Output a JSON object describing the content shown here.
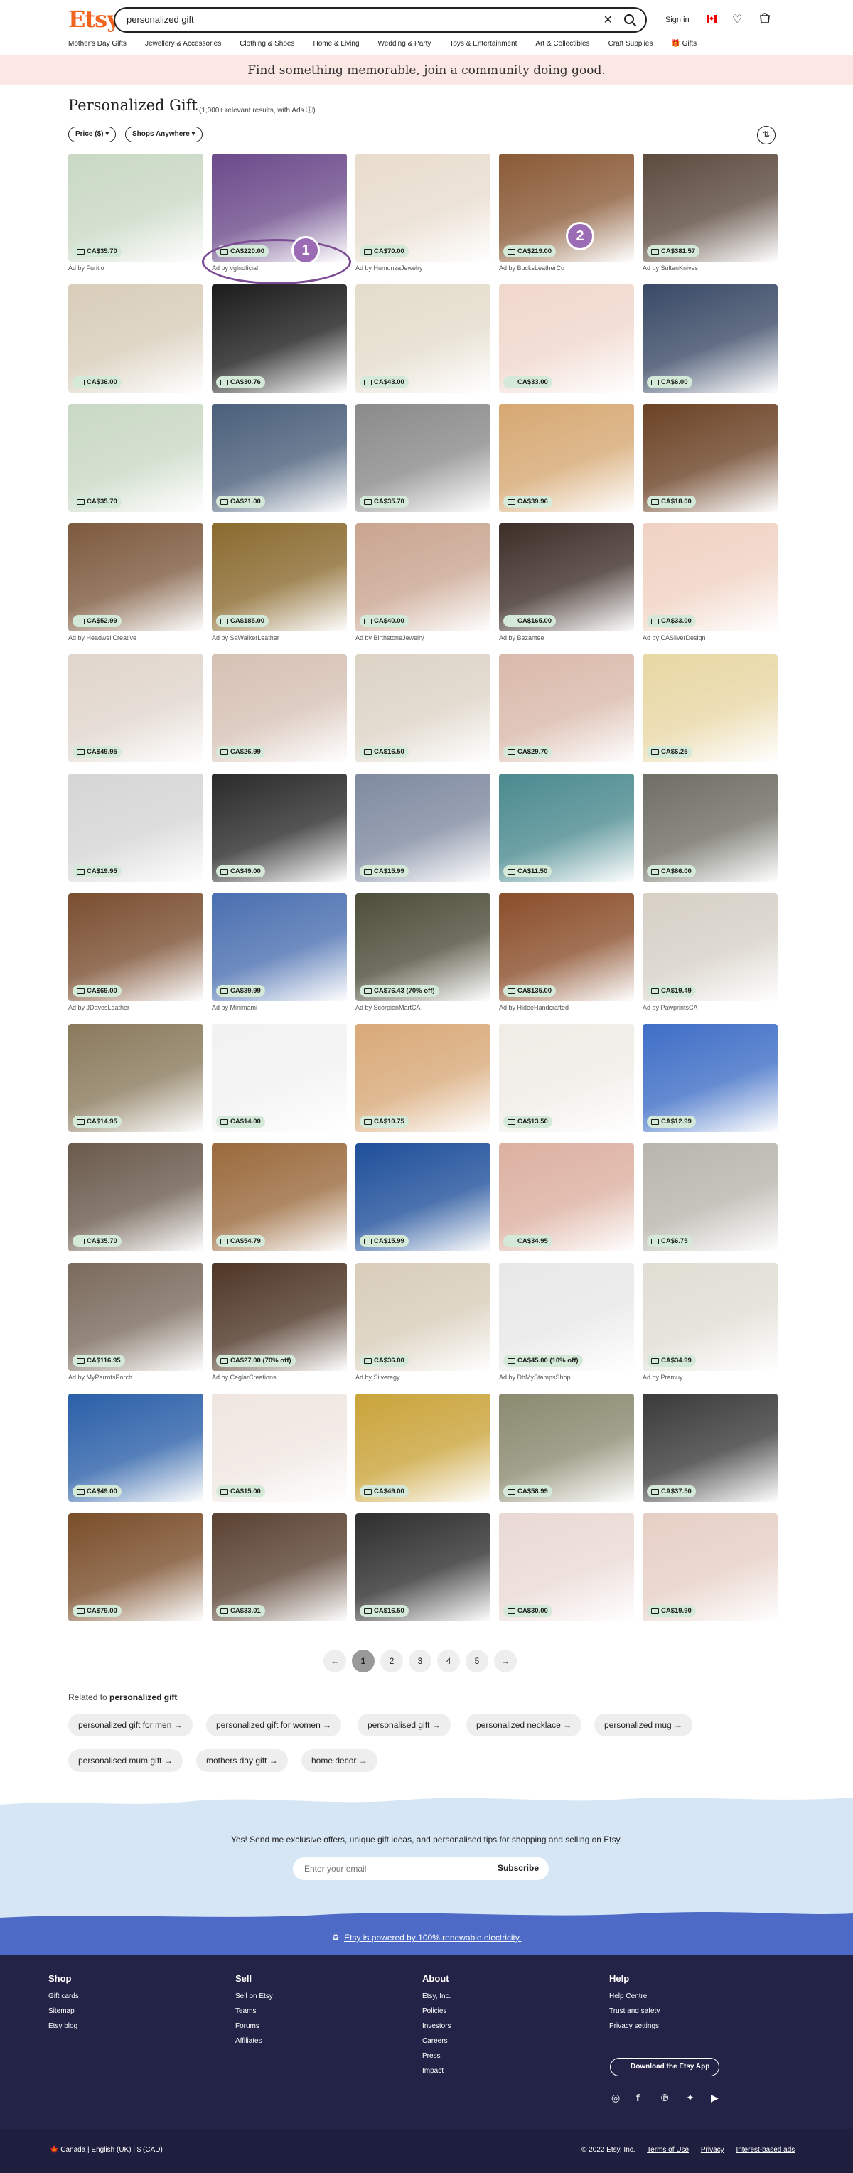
{
  "header": {
    "logo": "Etsy",
    "search_value": "personalized gift",
    "signin": "Sign in",
    "nav": [
      "Mother's Day Gifts",
      "Jewellery & Accessories",
      "Clothing & Shoes",
      "Home & Living",
      "Wedding & Party",
      "Toys & Entertainment",
      "Art & Collectibles",
      "Craft Supplies",
      "Gifts"
    ]
  },
  "banner": "Find something memorable, join a community doing good.",
  "results": {
    "title": "Personalized Gift",
    "count": "(1,000+ relevant results, with Ads",
    "filters": [
      "Price ($) ▾",
      "Shops Anywhere ▾"
    ]
  },
  "listings": [
    {
      "price": "CA$35.70",
      "ad": "Ad by Furitio",
      "color": "#c9d8c4"
    },
    {
      "price": "CA$220.00",
      "ad": "Ad by vglnoficial",
      "color": "#6b4a8a"
    },
    {
      "price": "CA$70.00",
      "ad": "Ad by HumunzaJewelry",
      "color": "#e8dccd"
    },
    {
      "price": "CA$219.00",
      "ad": "Ad by BucksLeatherCo",
      "color": "#8a5a36"
    },
    {
      "price": "CA$381.57",
      "ad": "Ad by SultanKnives",
      "color": "#5c4a3e"
    },
    {
      "price": "CA$36.00",
      "ad": "",
      "color": "#d8cdb9"
    },
    {
      "price": "CA$30.76",
      "ad": "",
      "color": "#1c1c1c"
    },
    {
      "price": "CA$43.00",
      "ad": "",
      "color": "#e4dccb"
    },
    {
      "price": "CA$33.00",
      "ad": "",
      "color": "#f0d7cc"
    },
    {
      "price": "CA$6.00",
      "ad": "",
      "color": "#3a4a66"
    },
    {
      "price": "CA$35.70",
      "ad": "",
      "color": "#c9d8c4"
    },
    {
      "price": "CA$21.00",
      "ad": "",
      "color": "#4a5f7a"
    },
    {
      "price": "CA$35.70",
      "ad": "",
      "color": "#8a8a8a"
    },
    {
      "price": "CA$39.96",
      "ad": "",
      "color": "#d6a872"
    },
    {
      "price": "CA$18.00",
      "ad": "",
      "color": "#6b4225"
    },
    {
      "price": "CA$52.99",
      "ad": "Ad by HeadwellCreative",
      "color": "#7d5a3e"
    },
    {
      "price": "CA$185.00",
      "ad": "Ad by SaWalkerLeather",
      "color": "#8a6a2e"
    },
    {
      "price": "CA$40.00",
      "ad": "Ad by BirthstoneJewelry",
      "color": "#c9a590"
    },
    {
      "price": "CA$165.00",
      "ad": "Ad by Bezantee",
      "color": "#3e2e28"
    },
    {
      "price": "CA$33.00",
      "ad": "Ad by CASilverDesign",
      "color": "#f0d2c2"
    },
    {
      "price": "CA$49.95",
      "ad": "",
      "color": "#e0d5cc"
    },
    {
      "price": "CA$26.99",
      "ad": "",
      "color": "#d6c1b4"
    },
    {
      "price": "CA$16.50",
      "ad": "",
      "color": "#dcd3c5"
    },
    {
      "price": "CA$29.70",
      "ad": "",
      "color": "#d9b9aa"
    },
    {
      "price": "CA$6.25",
      "ad": "",
      "color": "#e8d7a4"
    },
    {
      "price": "CA$19.95",
      "ad": "",
      "color": "#d5d5d5"
    },
    {
      "price": "CA$49.00",
      "ad": "",
      "color": "#2a2a2a"
    },
    {
      "price": "CA$15.99",
      "ad": "",
      "color": "#7f8aa0"
    },
    {
      "price": "CA$11.50",
      "ad": "",
      "color": "#4a8a8f"
    },
    {
      "price": "CA$86.00",
      "ad": "",
      "color": "#6e6e64"
    },
    {
      "price": "CA$69.00",
      "ad": "Ad by JDavesLeather",
      "color": "#7a4e30"
    },
    {
      "price": "CA$39.99",
      "ad": "Ad by Minimami",
      "color": "#4a6fb0"
    },
    {
      "price": "CA$76.43 (70% off)",
      "ad": "Ad by ScorpionMartCA",
      "color": "#4d4d3a"
    },
    {
      "price": "CA$135.00",
      "ad": "Ad by HideeHandcrafted",
      "color": "#8a4e2a"
    },
    {
      "price": "CA$19.49",
      "ad": "Ad by PawprintsCA",
      "color": "#d6d0c6"
    },
    {
      "price": "CA$14.95",
      "ad": "",
      "color": "#8a7a5c"
    },
    {
      "price": "CA$14.00",
      "ad": "",
      "color": "#f2f2f2"
    },
    {
      "price": "CA$10.75",
      "ad": "",
      "color": "#d8a978"
    },
    {
      "price": "CA$13.50",
      "ad": "",
      "color": "#f0ece6"
    },
    {
      "price": "CA$12.99",
      "ad": "",
      "color": "#3e6ec6"
    },
    {
      "price": "CA$35.70",
      "ad": "",
      "color": "#6a5a4c"
    },
    {
      "price": "CA$54.79",
      "ad": "",
      "color": "#9a6a3c"
    },
    {
      "price": "CA$15.99",
      "ad": "",
      "color": "#1e4f9a"
    },
    {
      "price": "CA$34.95",
      "ad": "",
      "color": "#dcb0a0"
    },
    {
      "price": "CA$6.75",
      "ad": "",
      "color": "#b8b5ac"
    },
    {
      "price": "CA$116.95",
      "ad": "Ad by MyParrotsPorch",
      "color": "#7a6a5c"
    },
    {
      "price": "CA$27.00 (70% off)",
      "ad": "Ad by CeglarCreations",
      "color": "#4e3626"
    },
    {
      "price": "CA$36.00",
      "ad": "Ad by Silveregy",
      "color": "#d8cdb9"
    },
    {
      "price": "CA$45.00 (10% off)",
      "ad": "Ad by DhMyStampsShop",
      "color": "#e8e8e8"
    },
    {
      "price": "CA$34.99",
      "ad": "Ad by Pramuy",
      "color": "#e0ddd3"
    },
    {
      "price": "CA$49.00",
      "ad": "",
      "color": "#2a5fa8"
    },
    {
      "price": "CA$15.00",
      "ad": "",
      "color": "#efe6e0"
    },
    {
      "price": "CA$49.00",
      "ad": "",
      "color": "#caa43a"
    },
    {
      "price": "CA$58.99",
      "ad": "",
      "color": "#8a8a70"
    },
    {
      "price": "CA$37.50",
      "ad": "",
      "color": "#3a3a3a"
    },
    {
      "price": "CA$79.00",
      "ad": "",
      "color": "#7a4e2a"
    },
    {
      "price": "CA$33.01",
      "ad": "",
      "color": "#5a4232"
    },
    {
      "price": "CA$16.50",
      "ad": "",
      "color": "#2e2e2e"
    },
    {
      "price": "CA$30.00",
      "ad": "",
      "color": "#ead9d4"
    },
    {
      "price": "CA$19.90",
      "ad": "",
      "color": "#e6cfc5"
    }
  ],
  "markers": [
    "1",
    "2"
  ],
  "pagination": [
    "←",
    "1",
    "2",
    "3",
    "4",
    "5",
    "→"
  ],
  "related": {
    "label": "Related to",
    "query": "personalized gift",
    "chips": [
      "personalized gift for men",
      "personalized gift for women",
      "personalised gift",
      "personalized necklace",
      "personalized mug",
      "personalised mum gift",
      "mothers day gift",
      "home decor"
    ]
  },
  "subscribe": {
    "text": "Yes! Send me exclusive offers, unique gift ideas, and personalised tips for shopping and selling on Etsy.",
    "placeholder": "Enter your email",
    "button": "Subscribe"
  },
  "renewable": "Etsy is powered by 100% renewable electricity.",
  "footer": {
    "columns": [
      {
        "title": "Shop",
        "items": [
          "Gift cards",
          "Sitemap",
          "Etsy blog"
        ]
      },
      {
        "title": "Sell",
        "items": [
          "Sell on Etsy",
          "Teams",
          "Forums",
          "Affiliates"
        ]
      },
      {
        "title": "About",
        "items": [
          "Etsy, Inc.",
          "Policies",
          "Investors",
          "Careers",
          "Press",
          "Impact"
        ]
      },
      {
        "title": "Help",
        "items": [
          "Help Centre",
          "Trust and safety",
          "Privacy settings"
        ]
      }
    ],
    "app_button": "Download the Etsy App",
    "locale": "Canada   |   English (UK)   |   $ (CAD)",
    "copyright": "© 2022 Etsy, Inc.",
    "links": [
      "Terms of Use",
      "Privacy",
      "Interest-based ads"
    ]
  },
  "colors": {
    "brand": "#f1641e",
    "price_tag": "#d4e9d7",
    "footer": "#232347",
    "renew": "#4d6bc6",
    "marker": "#9c6bb5"
  }
}
